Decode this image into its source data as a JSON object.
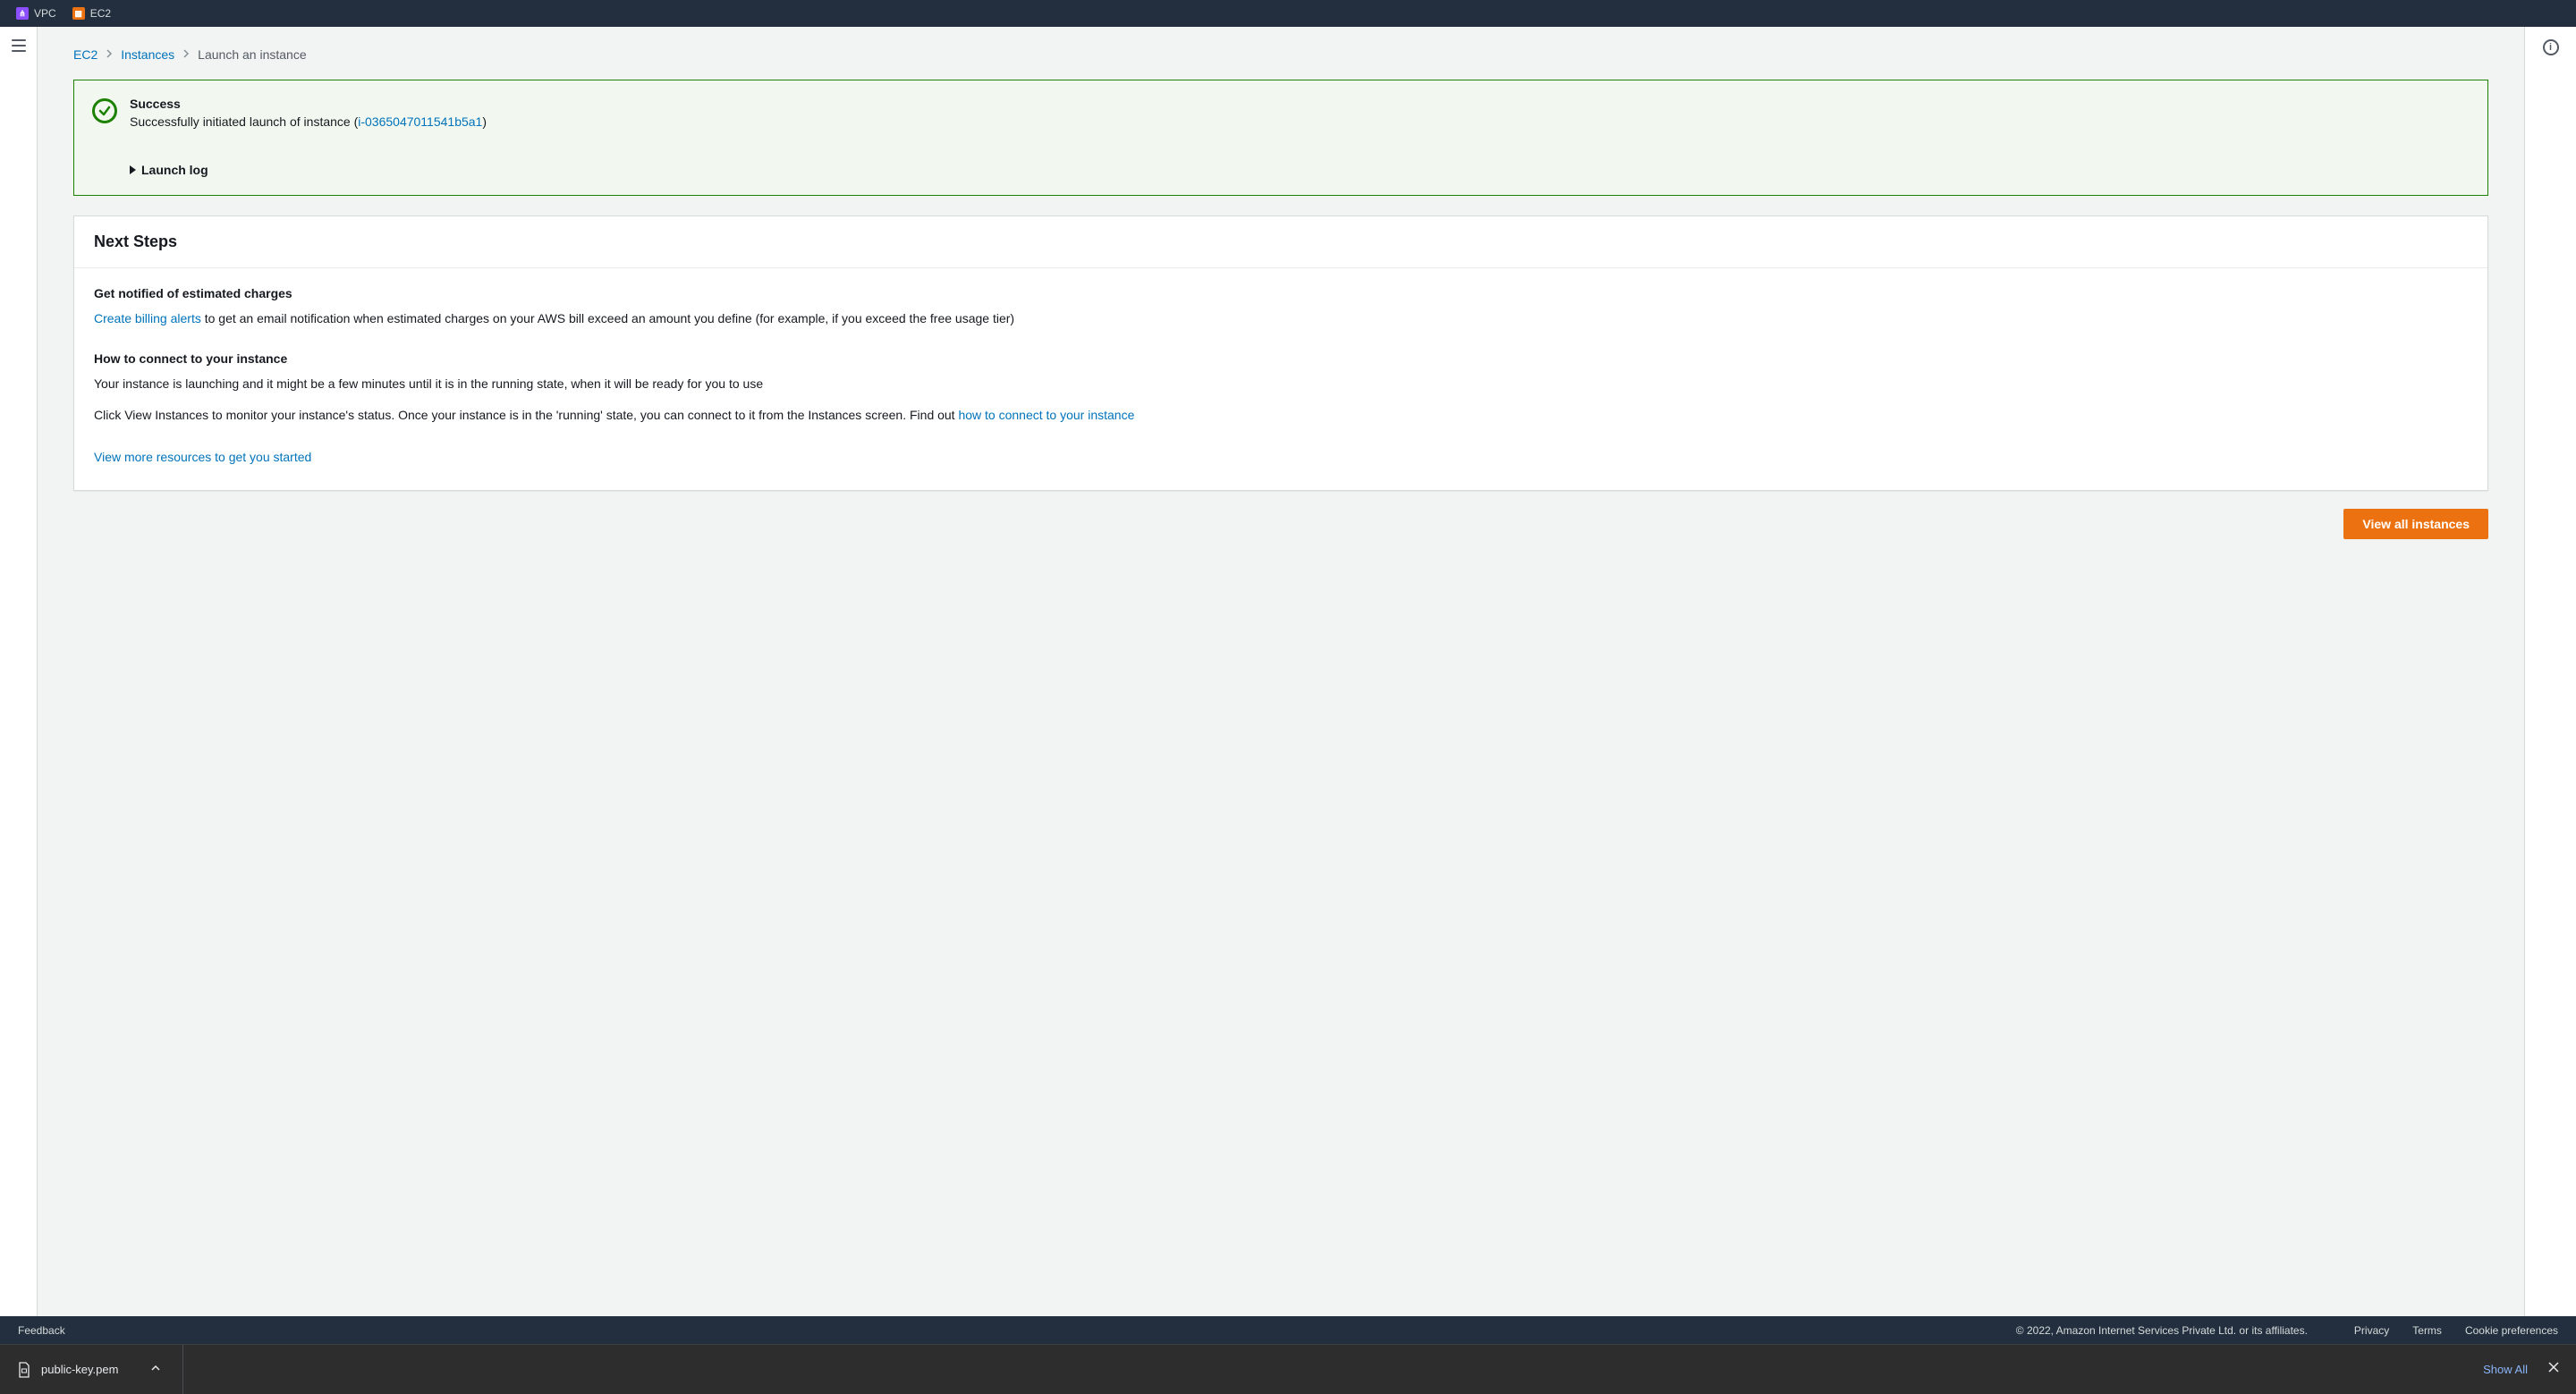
{
  "tabs": {
    "vpc": "VPC",
    "ec2": "EC2"
  },
  "breadcrumb": {
    "ec2": "EC2",
    "instances": "Instances",
    "current": "Launch an instance"
  },
  "alert": {
    "title": "Success",
    "msg_prefix": "Successfully initiated launch of instance (",
    "instance_id": "i-0365047011541b5a1",
    "msg_suffix": ")",
    "launch_log": "Launch log"
  },
  "next_steps": {
    "heading": "Next Steps",
    "billing": {
      "heading": "Get notified of estimated charges",
      "link": "Create billing alerts",
      "rest": " to get an email notification when estimated charges on your AWS bill exceed an amount you define (for example, if you exceed the free usage tier)"
    },
    "connect": {
      "heading": "How to connect to your instance",
      "p1": "Your instance is launching and it might be a few minutes until it is in the running state, when it will be ready for you to use",
      "p2_prefix": "Click View Instances to monitor your instance's status. Once your instance is in the 'running' state, you can connect to it from the Instances screen. Find out ",
      "p2_link": "how to connect to your instance"
    },
    "more_resources": "View more resources to get you started",
    "view_all": "View all instances"
  },
  "footer": {
    "feedback": "Feedback",
    "copyright": "© 2022, Amazon Internet Services Private Ltd. or its affiliates.",
    "privacy": "Privacy",
    "terms": "Terms",
    "cookie": "Cookie preferences"
  },
  "download": {
    "filename": "public-key.pem",
    "show_all": "Show All"
  }
}
